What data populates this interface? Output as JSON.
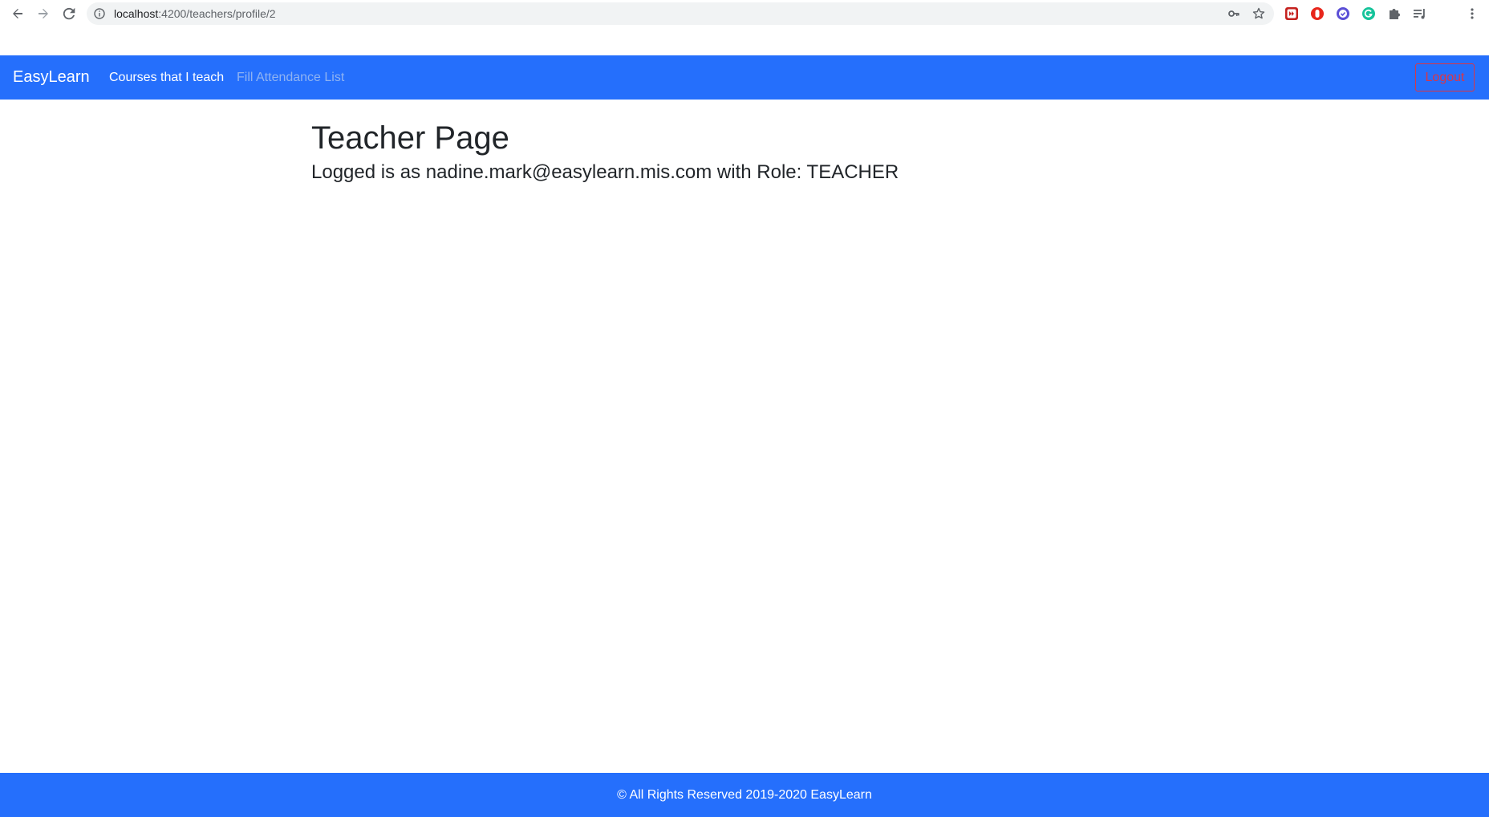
{
  "browser": {
    "url_host": "localhost",
    "url_rest": ":4200/teachers/profile/2"
  },
  "navbar": {
    "brand": "EasyLearn",
    "links": [
      {
        "label": "Courses that I teach",
        "state": "active"
      },
      {
        "label": "Fill Attendance List",
        "state": "muted"
      }
    ],
    "logout_label": "Logout"
  },
  "main": {
    "title": "Teacher Page",
    "logged_text": "Logged is as nadine.mark@easylearn.mis.com with Role: TEACHER"
  },
  "footer": {
    "text": "© All Rights Reserved 2019-2020 EasyLearn"
  },
  "colors": {
    "navbar_bg": "#256ffc",
    "logout_accent": "#dc3545",
    "text_dark": "#212529"
  }
}
